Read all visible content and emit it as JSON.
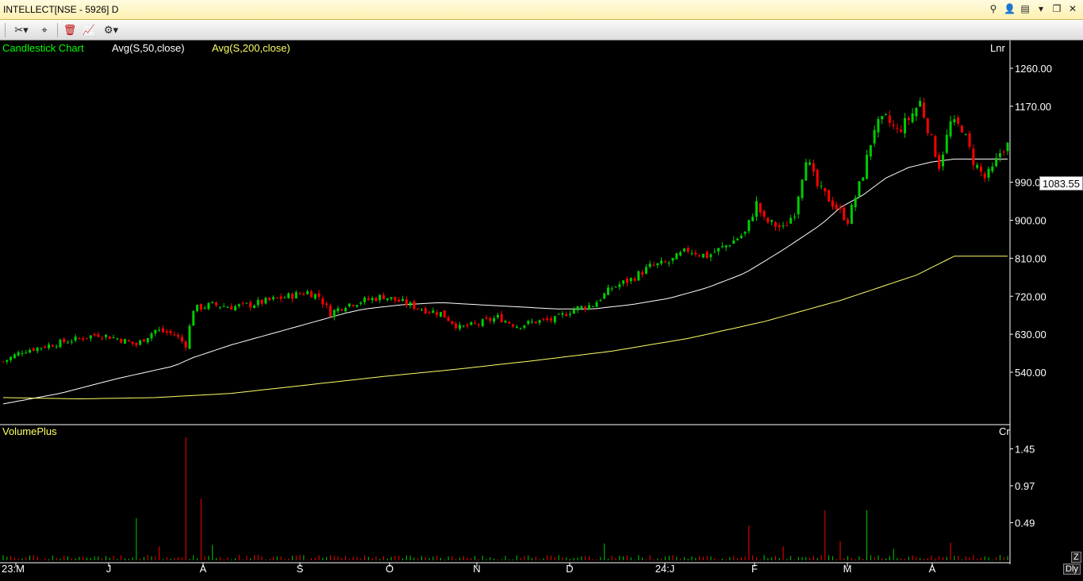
{
  "window": {
    "title": "INTELLECT[NSE - 5926] D",
    "buttons": [
      "search-icon",
      "user-icon",
      "print-icon",
      "dropdown-icon",
      "restore-icon",
      "close-icon"
    ]
  },
  "toolbar": {
    "items": [
      "draw-tools-icon",
      "cursor-tools-icon",
      "delete-icon",
      "indicator-icon",
      "settings-icon"
    ]
  },
  "colors": {
    "background": "#000000",
    "up": "#00cc00",
    "down": "#ff0000",
    "avg50": "#ffffff",
    "avg200": "#ffff66",
    "legend_label": "#00ff00",
    "text": "#ffffff"
  },
  "legend": {
    "chart_type_label": "Candlestick Chart",
    "avg50_label": "Avg(S,50,close)",
    "avg200_label": "Avg(S,200,close)",
    "scale_label": "Lnr"
  },
  "volume": {
    "label": "VolumePlus",
    "unit_label": "Cr",
    "ticks": [
      "1.45",
      "0.97",
      "0.49"
    ]
  },
  "last_price": "1083.55",
  "price_ticks": [
    "1260.00",
    "1170.00",
    "990.00",
    "900.00",
    "810.00",
    "720.00",
    "630.00",
    "540.00"
  ],
  "x_ticks": [
    "23:M",
    "J",
    "A",
    "S",
    "O",
    "N",
    "D",
    "24:J",
    "F",
    "M",
    "A"
  ],
  "corner_buttons": {
    "zoom": "Z",
    "period": "Dly"
  },
  "chart_data": [
    {
      "type": "candlestick",
      "title": "Candlestick Chart",
      "xlabel": "",
      "ylabel": "",
      "ylim": [
        450,
        1290
      ],
      "scale": "linear",
      "x_range": [
        "2023-05-25",
        "2024-04-30"
      ],
      "series": [
        {
          "name": "Avg(S,50,close)",
          "values": [],
          "keypoints": [
            [
              0,
              465
            ],
            [
              15,
              490
            ],
            [
              30,
              525
            ],
            [
              45,
              555
            ],
            [
              50,
              575
            ],
            [
              60,
              605
            ],
            [
              70,
              630
            ],
            [
              80,
              655
            ],
            [
              90,
              680
            ],
            [
              95,
              690
            ],
            [
              105,
              700
            ],
            [
              115,
              705
            ],
            [
              125,
              700
            ],
            [
              135,
              695
            ],
            [
              145,
              690
            ],
            [
              155,
              690
            ],
            [
              165,
              700
            ],
            [
              175,
              715
            ],
            [
              185,
              740
            ],
            [
              195,
              775
            ],
            [
              205,
              830
            ],
            [
              215,
              890
            ],
            [
              220,
              930
            ],
            [
              226,
              960
            ],
            [
              232,
              1000
            ],
            [
              238,
              1025
            ],
            [
              244,
              1038
            ],
            [
              250,
              1045
            ]
          ]
        },
        {
          "name": "Avg(S,200,close)",
          "values": [],
          "keypoints": [
            [
              0,
              480
            ],
            [
              20,
              477
            ],
            [
              40,
              480
            ],
            [
              60,
              490
            ],
            [
              80,
              510
            ],
            [
              100,
              530
            ],
            [
              120,
              548
            ],
            [
              140,
              568
            ],
            [
              160,
              590
            ],
            [
              180,
              620
            ],
            [
              200,
              660
            ],
            [
              220,
              710
            ],
            [
              240,
              770
            ],
            [
              250,
              815
            ]
          ]
        }
      ],
      "keyframe_closes": [
        [
          0,
          565
        ],
        [
          5,
          590
        ],
        [
          10,
          600
        ],
        [
          15,
          610
        ],
        [
          20,
          620
        ],
        [
          25,
          630
        ],
        [
          30,
          620
        ],
        [
          35,
          605
        ],
        [
          40,
          640
        ],
        [
          45,
          630
        ],
        [
          48,
          605
        ],
        [
          50,
          690
        ],
        [
          55,
          700
        ],
        [
          60,
          695
        ],
        [
          65,
          700
        ],
        [
          70,
          710
        ],
        [
          75,
          720
        ],
        [
          80,
          730
        ],
        [
          83,
          720
        ],
        [
          86,
          680
        ],
        [
          90,
          700
        ],
        [
          95,
          710
        ],
        [
          100,
          720
        ],
        [
          105,
          705
        ],
        [
          110,
          690
        ],
        [
          115,
          680
        ],
        [
          120,
          645
        ],
        [
          125,
          655
        ],
        [
          130,
          670
        ],
        [
          135,
          650
        ],
        [
          140,
          660
        ],
        [
          145,
          665
        ],
        [
          150,
          690
        ],
        [
          155,
          700
        ],
        [
          160,
          740
        ],
        [
          165,
          760
        ],
        [
          170,
          790
        ],
        [
          175,
          800
        ],
        [
          180,
          830
        ],
        [
          185,
          815
        ],
        [
          190,
          840
        ],
        [
          195,
          870
        ],
        [
          198,
          940
        ],
        [
          200,
          900
        ],
        [
          205,
          880
        ],
        [
          208,
          920
        ],
        [
          211,
          1050
        ],
        [
          214,
          980
        ],
        [
          218,
          940
        ],
        [
          222,
          900
        ],
        [
          226,
          1010
        ],
        [
          229,
          1120
        ],
        [
          232,
          1140
        ],
        [
          235,
          1110
        ],
        [
          238,
          1140
        ],
        [
          241,
          1180
        ],
        [
          243,
          1120
        ],
        [
          246,
          1030
        ],
        [
          249,
          1130
        ],
        [
          252,
          1120
        ],
        [
          255,
          1040
        ],
        [
          258,
          1000
        ],
        [
          260,
          1020
        ],
        [
          262,
          1060
        ],
        [
          264,
          1083.55
        ]
      ]
    },
    {
      "type": "bar",
      "title": "VolumePlus",
      "ylabel": "Cr",
      "ylim": [
        0,
        1.6
      ],
      "categories": [],
      "values": [],
      "spikes": [
        [
          35,
          0.55
        ],
        [
          41,
          0.18
        ],
        [
          48,
          1.6
        ],
        [
          52,
          0.8
        ],
        [
          55,
          0.2
        ],
        [
          158,
          0.22
        ],
        [
          196,
          0.45
        ],
        [
          205,
          0.18
        ],
        [
          216,
          0.65
        ],
        [
          220,
          0.25
        ],
        [
          227,
          0.65
        ],
        [
          234,
          0.15
        ],
        [
          249,
          0.23
        ]
      ]
    }
  ]
}
